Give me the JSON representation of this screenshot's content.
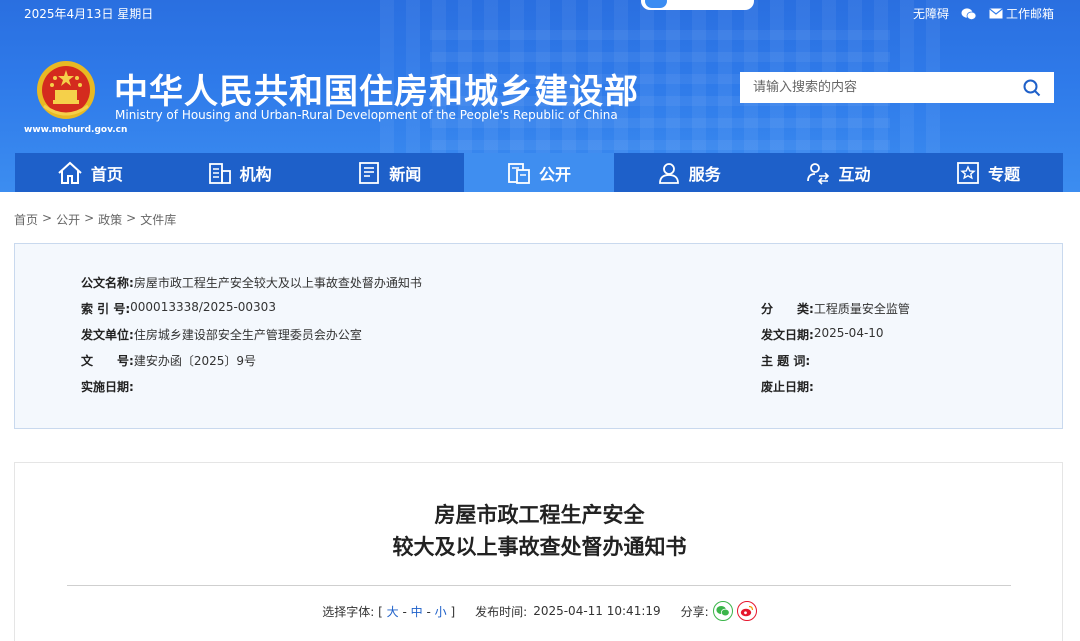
{
  "topbar": {
    "date": "2025年4月13日 星期日",
    "accessibility": "无障碍",
    "work_mail": "工作邮箱"
  },
  "header": {
    "title_cn": "中华人民共和国住房和城乡建设部",
    "title_en": "Ministry of Housing and Urban-Rural Development of the People's Republic of China",
    "site_url": "www.mohurd.gov.cn"
  },
  "search": {
    "placeholder": "请输入搜索的内容"
  },
  "nav": {
    "items": [
      {
        "label": "首页",
        "icon": "home-icon"
      },
      {
        "label": "机构",
        "icon": "building-icon"
      },
      {
        "label": "新闻",
        "icon": "news-icon"
      },
      {
        "label": "公开",
        "icon": "document-icon"
      },
      {
        "label": "服务",
        "icon": "user-service-icon"
      },
      {
        "label": "互动",
        "icon": "interaction-icon"
      },
      {
        "label": "专题",
        "icon": "star-icon"
      }
    ],
    "active_index": 3
  },
  "breadcrumb": [
    "首页",
    "公开",
    "政策",
    "文件库"
  ],
  "meta": {
    "doc_name_label": "公文名称:",
    "doc_name": "房屋市政工程生产安全较大及以上事故查处督办通知书",
    "index_label": "索 引 号:",
    "index": "000013338/2025-00303",
    "category_label": "分　　类:",
    "category": "工程质量安全监管",
    "issuer_label": "发文单位:",
    "issuer": "住房城乡建设部安全生产管理委员会办公室",
    "issue_date_label": "发文日期:",
    "issue_date": "2025-04-10",
    "doc_no_label": "文　　号:",
    "doc_no": "建安办函〔2025〕9号",
    "keywords_label": "主 题 词:",
    "impl_date_label": "实施日期:",
    "expire_date_label": "废止日期:"
  },
  "article": {
    "title_line1": "房屋市政工程生产安全",
    "title_line2": "较大及以上事故查处督办通知书",
    "font_label": "选择字体:",
    "font_large": "大",
    "font_medium": "中",
    "font_small": "小",
    "publish_label": "发布时间:",
    "publish_time": "2025-04-11 10:41:19",
    "share_label": "分享:"
  },
  "colors": {
    "header_blue": "#2f7bea",
    "nav_blue": "#1e60c9",
    "nav_active": "#3f8ef0",
    "wechat_green": "#3bb54a",
    "weibo_red": "#e6162d"
  }
}
